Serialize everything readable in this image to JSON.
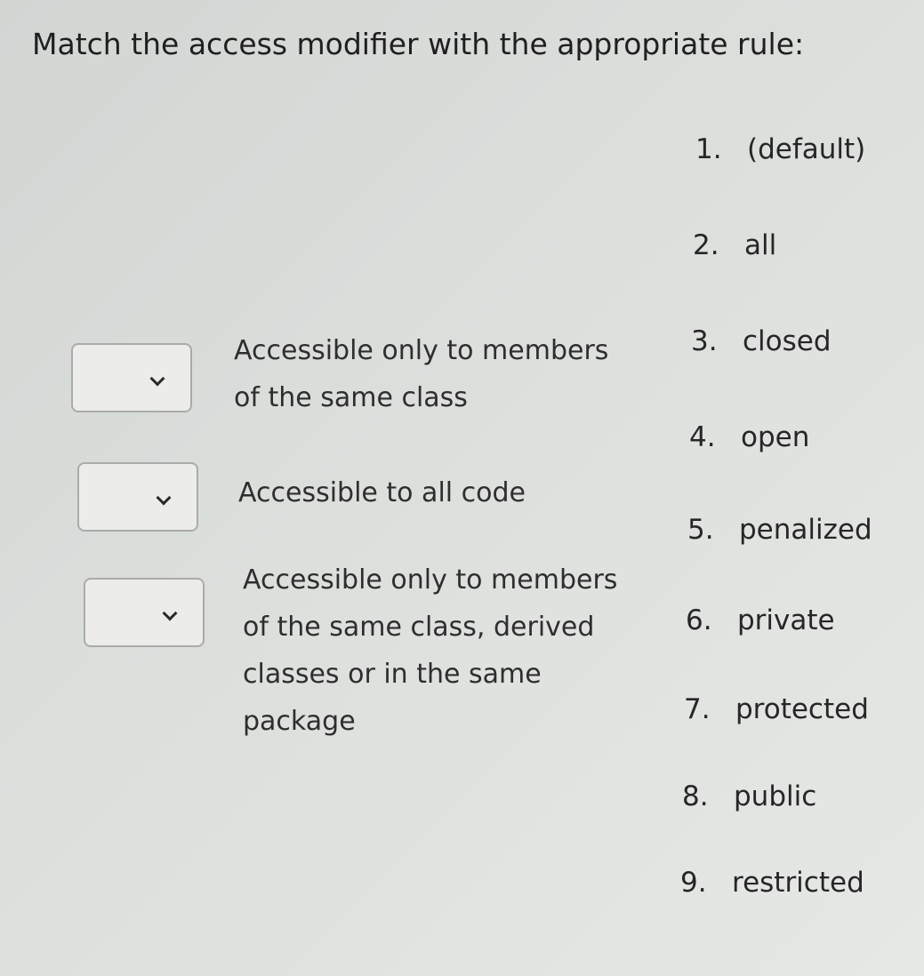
{
  "question": "Match the access modifier with the appropriate rule:",
  "rules": [
    {
      "lines": [
        "Accessible only to members",
        "of the same class"
      ]
    },
    {
      "lines": [
        "Accessible to all code"
      ]
    },
    {
      "lines": [
        "Accessible only to members",
        "of the same class, derived",
        "classes or in the same",
        "package"
      ]
    }
  ],
  "options": [
    {
      "num": "1.",
      "label": "(default)"
    },
    {
      "num": "2.",
      "label": "all"
    },
    {
      "num": "3.",
      "label": "closed"
    },
    {
      "num": "4.",
      "label": "open"
    },
    {
      "num": "5.",
      "label": "penalized"
    },
    {
      "num": "6.",
      "label": "private"
    },
    {
      "num": "7.",
      "label": "protected"
    },
    {
      "num": "8.",
      "label": "public"
    },
    {
      "num": "9.",
      "label": "restricted"
    }
  ],
  "dropdown_icon": "chevron-down-icon"
}
